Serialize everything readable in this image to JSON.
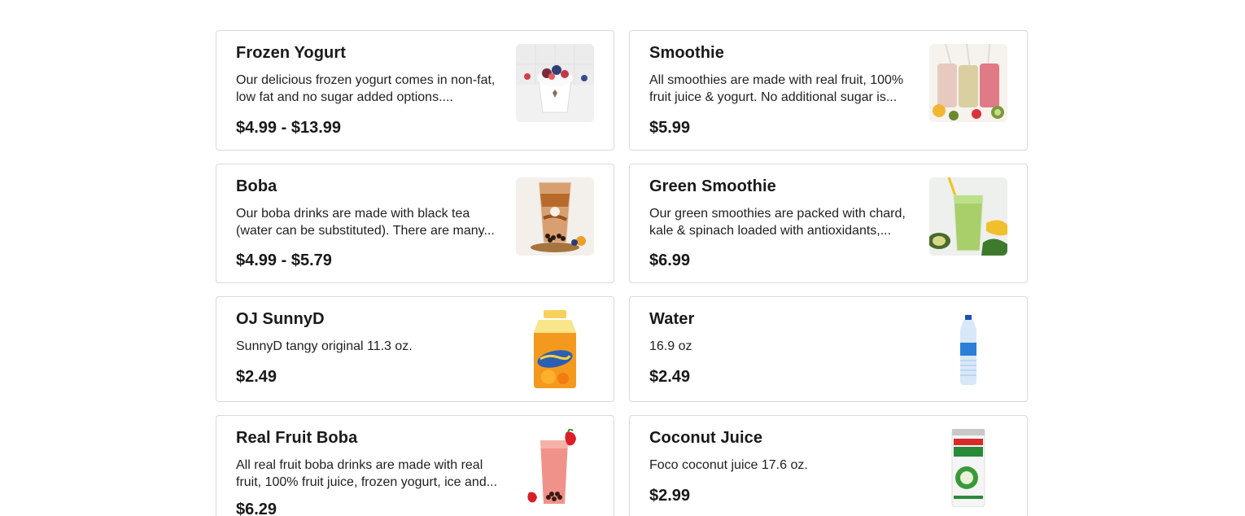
{
  "items": [
    {
      "title": "Frozen Yogurt",
      "description": "Our delicious frozen yogurt comes in non-fat, low fat and no sugar added options....",
      "price": "$4.99 - $13.99",
      "image": "frozen-yogurt-image"
    },
    {
      "title": "Smoothie",
      "description": "All smoothies are made with real fruit, 100% fruit juice & yogurt. No additional sugar is...",
      "price": "$5.99",
      "image": "smoothie-image"
    },
    {
      "title": "Boba",
      "description": "Our boba drinks are made with black tea (water can be substituted). There are many...",
      "price": "$4.99 - $5.79",
      "image": "boba-image"
    },
    {
      "title": "Green Smoothie",
      "description": "Our green smoothies are packed with chard, kale & spinach loaded with antioxidants,...",
      "price": "$6.99",
      "image": "green-smoothie-image"
    },
    {
      "title": "OJ SunnyD",
      "description": "SunnyD tangy original 11.3 oz.",
      "price": "$2.49",
      "image": "sunnyd-bottle-image"
    },
    {
      "title": "Water",
      "description": "16.9 oz",
      "price": "$2.49",
      "image": "water-bottle-image"
    },
    {
      "title": "Real Fruit Boba",
      "description": "All real fruit boba drinks are made with real fruit, 100% fruit juice, frozen yogurt, ice and...",
      "price": "$6.29",
      "image": "real-fruit-boba-image"
    },
    {
      "title": "Coconut Juice",
      "description": "Foco coconut juice 17.6 oz.",
      "price": "$2.99",
      "image": "coconut-juice-can-image"
    }
  ]
}
